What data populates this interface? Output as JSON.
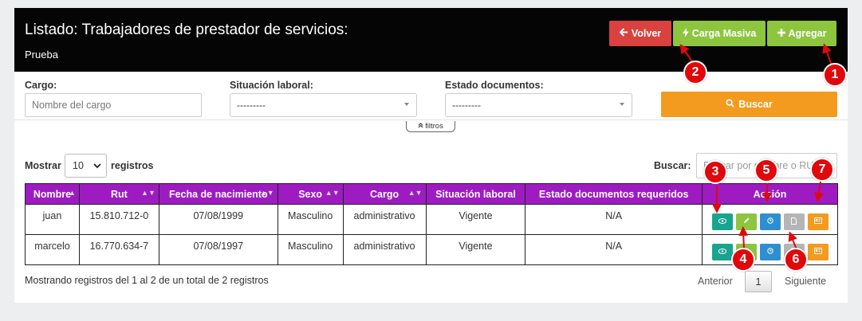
{
  "header": {
    "title": "Listado: Trabajadores de prestador de servicios:",
    "subtitle": "Prueba",
    "buttons": {
      "volver": "Volver",
      "carga_masiva": "Carga Masiva",
      "agregar": "Agregar"
    }
  },
  "filters": {
    "cargo_label": "Cargo:",
    "cargo_placeholder": "Nombre del cargo",
    "situacion_label": "Situación laboral:",
    "situacion_value": "---------",
    "estado_label": "Estado documentos:",
    "estado_value": "---------",
    "buscar_button": "Buscar",
    "filtros_toggle": "filtros"
  },
  "table_controls": {
    "mostrar": "Mostrar",
    "page_length": "10",
    "registros": "registros",
    "search_label": "Buscar:",
    "search_placeholder": "Buscar por nombre o RUT"
  },
  "table": {
    "columns": [
      "Nombre",
      "Rut",
      "Fecha de nacimiento",
      "Sexo",
      "Cargo",
      "Situación laboral",
      "Estado documentos requeridos",
      "Acción"
    ],
    "rows": [
      {
        "nombre": "juan",
        "rut": "15.810.712-0",
        "fecha": "07/08/1999",
        "sexo": "Masculino",
        "cargo": "administrativo",
        "situacion": "Vigente",
        "estado": "N/A"
      },
      {
        "nombre": "marcelo",
        "rut": "16.770.634-7",
        "fecha": "07/08/1997",
        "sexo": "Masculino",
        "cargo": "administrativo",
        "situacion": "Vigente",
        "estado": "N/A"
      }
    ],
    "action_icons": [
      "eye-icon",
      "pencil-icon",
      "clock-icon",
      "document-icon",
      "id-card-icon"
    ]
  },
  "footer": {
    "info": "Mostrando registros del 1 al 2 de un total de 2 registros",
    "prev": "Anterior",
    "page": "1",
    "next": "Siguiente"
  },
  "annotations": [
    "1",
    "2",
    "3",
    "4",
    "5",
    "6",
    "7"
  ],
  "colors": {
    "header_bg": "#050505",
    "volver": "#d9423f",
    "green": "#8dc53f",
    "orange": "#f39b1f",
    "table_header": "#9e1bc2",
    "teal": "#17a58f",
    "blue": "#2e8fd0",
    "gray": "#b5b5b5",
    "badge_red": "#e0080b"
  }
}
